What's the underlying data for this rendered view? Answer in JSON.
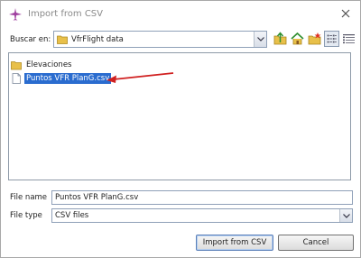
{
  "window": {
    "title": "Import from CSV"
  },
  "lookin": {
    "label": "Buscar en:",
    "value": "VfrFlight data"
  },
  "toolbar": {
    "icons": [
      "folder-up-icon",
      "home-icon",
      "new-folder-icon",
      "list-view-icon",
      "details-view-icon"
    ],
    "pressed": "list-view-icon"
  },
  "files": [
    {
      "name": "Elevaciones",
      "type": "folder",
      "selected": false
    },
    {
      "name": "Puntos VFR PlanG.csv",
      "type": "file",
      "selected": true
    }
  ],
  "filename": {
    "label": "File name",
    "value": "Puntos VFR PlanG.csv"
  },
  "filetype": {
    "label": "File type",
    "value": "CSV files"
  },
  "buttons": {
    "import": "Import from CSV",
    "cancel": "Cancel"
  },
  "colors": {
    "selection": "#2a6ccf",
    "annotation_arrow": "#d02020",
    "folder": "#e8c04a"
  }
}
